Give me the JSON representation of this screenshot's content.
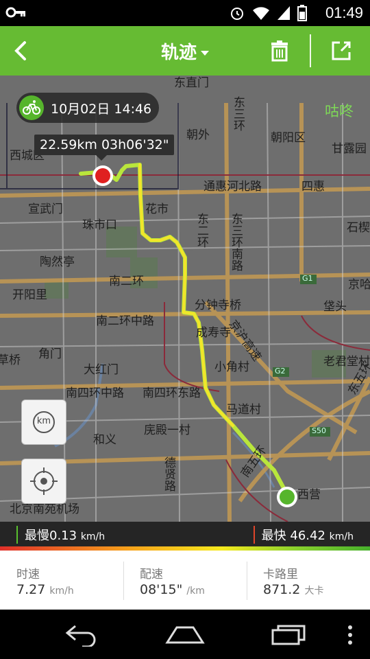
{
  "status_bar": {
    "time": "01:49"
  },
  "app_bar": {
    "title": "轨迹"
  },
  "map": {
    "labels": {
      "dongzhimen": "东直门",
      "chaowai": "朝外",
      "chaoyangqu": "朝阳区",
      "ganluyuan": "甘露园",
      "dongsanhuan_n": "东三环",
      "xicheng": "西城区",
      "tonghuihebeilu": "通惠河北路",
      "sihui": "四惠",
      "xuanwumen": "宣武门",
      "huashi": "花市",
      "zhushikou": "珠市口",
      "dongerhuan": "东二环",
      "dongsanhuan_nanlu": "东三环南路",
      "taoranting": "陶然亭",
      "shiying": "石楔",
      "nanerhuan": "南二环",
      "jingtong": "京哈",
      "kaiyangli": "开阳里",
      "fenzhongsiqiao": "分钟寺桥",
      "guitou": "垡头",
      "nanerhuanzhonglu": "南二环中路",
      "chengshousi": "成寿寺",
      "jinghugaosu": "京沪高速",
      "caoqiao": "草桥",
      "jiaomen": "角门",
      "dahongmen": "大红门",
      "xiaojiaocun": "小角村",
      "laojuntangcun": "老君堂村",
      "nansihuanzhonglu": "南四环中路",
      "nansihuandonglu": "南四环东路",
      "madaocun": "马道村",
      "dongwuhuan": "东五环",
      "heyi": "和义",
      "yuandianyicun": "庑殿一村",
      "debinlu": "德贤路",
      "nanwuhuan": "南五环",
      "xiying": "西营",
      "nanyuanjichang": "北京南苑机场",
      "g1": "G1",
      "g2": "G2",
      "s50": "S50"
    },
    "ride_date": "10月02日 14:46",
    "ride_summary": "22.59km  03h06'32\"",
    "brand": "咕咚",
    "km_button": "km"
  },
  "speed_bar": {
    "slowest_label": "最慢",
    "slowest_value": "0.13",
    "slowest_unit": "km/h",
    "fastest_label": "最快",
    "fastest_value": "46.42",
    "fastest_unit": "km/h"
  },
  "info": {
    "speed_label": "时速",
    "speed_value": "7.27",
    "speed_unit": "km/h",
    "pace_label": "配速",
    "pace_value": "08'15\"",
    "pace_unit": "/km",
    "calories_label": "卡路里",
    "calories_value": "871.2",
    "calories_unit": "大卡"
  },
  "colors": {
    "app_bar": "#66bb33",
    "route_start": "#e02020",
    "route_end": "#56b52c",
    "route_mid": "#f6ea1e"
  }
}
